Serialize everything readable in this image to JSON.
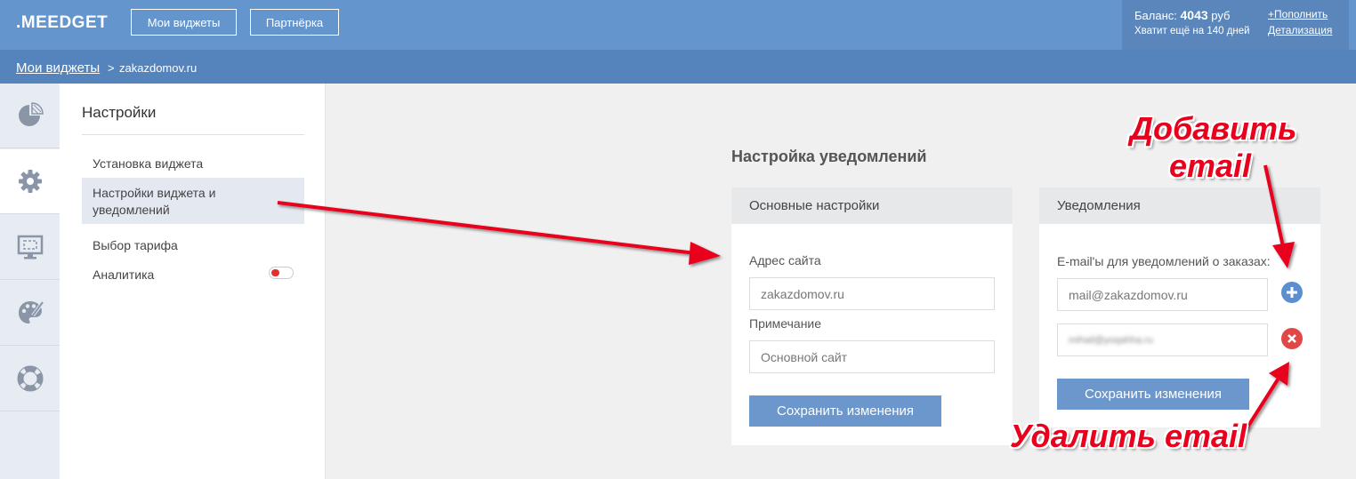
{
  "header": {
    "logo": ".MEEDGET",
    "nav": [
      "Мои виджеты",
      "Партнёрка"
    ],
    "balance_label": "Баланс:",
    "balance_amount": "4043",
    "balance_currency": "руб",
    "balance_days": "Хватит ещё на 140 дней",
    "topup_plus": "+",
    "topup_label": "Пополнить",
    "details_label": "Детализация"
  },
  "breadcrumb": {
    "root": "Мои виджеты",
    "separator": ">",
    "current": "zakazdomov.ru"
  },
  "rail": [
    "pie-chart-icon",
    "gear-icon",
    "screen-icon",
    "palette-icon",
    "lifebuoy-icon"
  ],
  "settings": {
    "title": "Настройки",
    "items": [
      {
        "label": "Установка виджета"
      },
      {
        "label": "Настройки виджета и уведомлений"
      },
      {
        "label": "Выбор тарифа"
      },
      {
        "label": "Аналитика"
      }
    ]
  },
  "main": {
    "section_title": "Настройка уведомлений",
    "basic": {
      "header": "Основные настройки",
      "site_label": "Адрес сайта",
      "site_value": "zakazdomov.ru",
      "note_label": "Примечание",
      "note_value": "Основной сайт",
      "save": "Сохранить изменения"
    },
    "notifications": {
      "header": "Уведомления",
      "emails_label": "E-mail'ы для уведомлений о заказах:",
      "email_1": "mail@zakazdomov.ru",
      "email_2": "mihail@yoqahha.ru",
      "save": "Сохранить изменения"
    }
  },
  "annotations": {
    "add_line1": "Добавить",
    "add_line2": "email",
    "delete": "Удалить email"
  },
  "colors": {
    "header": "#6595cd",
    "breadcrumb": "#5583bc",
    "button": "#6b97cc",
    "add": "#5b8fd0",
    "delete": "#e04848",
    "annotation": "#e8001c"
  }
}
